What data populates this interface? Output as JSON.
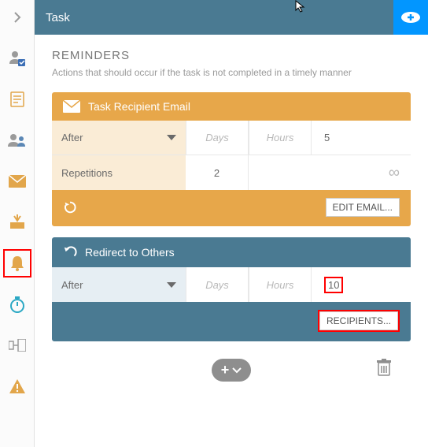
{
  "header": {
    "title": "Task"
  },
  "section": {
    "title": "REMINDERS",
    "subtitle": "Actions that should occur if the task is not completed in a timely manner"
  },
  "card1": {
    "title": "Task Recipient Email",
    "after_label": "After",
    "days": "Days",
    "hours": "Hours",
    "hours_val": "5",
    "rep_label": "Repetitions",
    "rep_val": "2",
    "edit_btn": "EDIT EMAIL..."
  },
  "card2": {
    "title": "Redirect to Others",
    "after_label": "After",
    "days": "Days",
    "hours": "Hours",
    "hours_val": "10",
    "recipients_btn": "RECIPIENTS..."
  },
  "infinity_symbol": "∞"
}
